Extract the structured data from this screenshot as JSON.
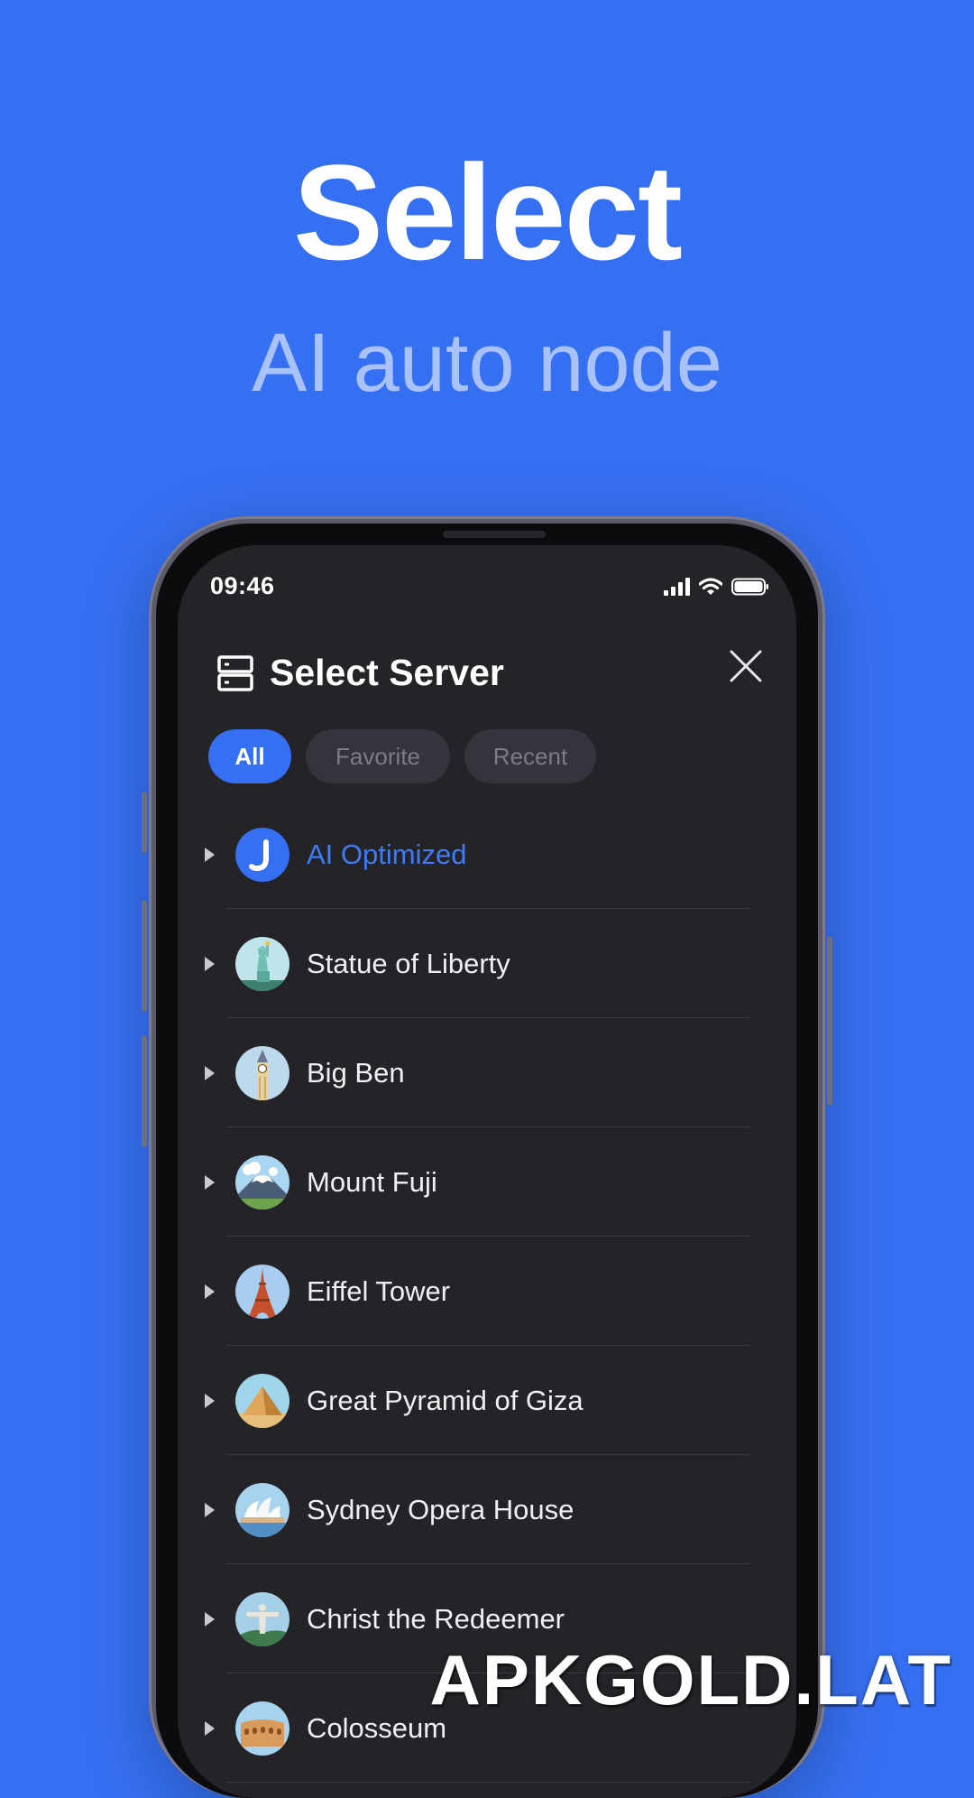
{
  "promo": {
    "headline": "Select",
    "subheadline": "AI auto node"
  },
  "status_bar": {
    "time": "09:46",
    "icons": [
      "signal-icon",
      "wifi-icon",
      "battery-icon"
    ]
  },
  "header": {
    "icon": "server-icon",
    "title": "Select Server",
    "close_icon": "close-icon"
  },
  "tabs": [
    {
      "label": "All",
      "active": true
    },
    {
      "label": "Favorite",
      "active": false
    },
    {
      "label": "Recent",
      "active": false
    }
  ],
  "servers": [
    {
      "label": "AI Optimized",
      "icon": "ai-logo-icon"
    },
    {
      "label": "Statue of Liberty",
      "icon": "statue-of-liberty-icon"
    },
    {
      "label": "Big Ben",
      "icon": "big-ben-icon"
    },
    {
      "label": "Mount Fuji",
      "icon": "mount-fuji-icon"
    },
    {
      "label": "Eiffel Tower",
      "icon": "eiffel-tower-icon"
    },
    {
      "label": "Great Pyramid of Giza",
      "icon": "pyramid-icon"
    },
    {
      "label": "Sydney Opera House",
      "icon": "opera-house-icon"
    },
    {
      "label": "Christ the Redeemer",
      "icon": "christ-redeemer-icon"
    },
    {
      "label": "Colosseum",
      "icon": "colosseum-icon"
    }
  ],
  "watermark": "APKGOLD.LAT",
  "colors": {
    "background": "#3670f2",
    "accent": "#3f7bf5",
    "screen": "#242428",
    "tab_inactive": "#33343c"
  }
}
